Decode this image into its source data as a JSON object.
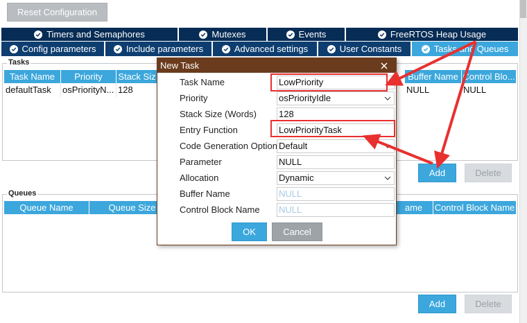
{
  "toolbar": {
    "reset_label": "Reset Configuration"
  },
  "tabs_row1": [
    {
      "label": "Timers and Semaphores"
    },
    {
      "label": "Mutexes"
    },
    {
      "label": "Events"
    },
    {
      "label": "FreeRTOS Heap Usage"
    }
  ],
  "tabs_row2": [
    {
      "label": "Config parameters"
    },
    {
      "label": "Include parameters"
    },
    {
      "label": "Advanced settings"
    },
    {
      "label": "User Constants"
    },
    {
      "label": "Tasks and Queues",
      "active": true
    }
  ],
  "tasks": {
    "title": "Tasks",
    "columns": [
      "Task Name",
      "Priority",
      "Stack Siz",
      "Buffer Name",
      "Control Blo..."
    ],
    "row": {
      "task_name": "defaultTask",
      "priority": "osPriorityN...",
      "stack": "128",
      "buffer": "NULL",
      "control": "NULL"
    },
    "add_label": "Add",
    "delete_label": "Delete"
  },
  "queues": {
    "title": "Queues",
    "columns": [
      "Queue Name",
      "Queue Size",
      "ame",
      "Control Block Name"
    ],
    "add_label": "Add",
    "delete_label": "Delete"
  },
  "dialog": {
    "title": "New Task",
    "fields": {
      "task_name": {
        "label": "Task Name",
        "value": "LowPriority"
      },
      "priority": {
        "label": "Priority",
        "value": "osPriorityIdle"
      },
      "stack_size": {
        "label": "Stack Size (Words)",
        "value": "128"
      },
      "entry_function": {
        "label": "Entry Function",
        "value": "LowPriorityTask"
      },
      "code_gen": {
        "label": "Code Generation Option",
        "value": "Default"
      },
      "parameter": {
        "label": "Parameter",
        "value": "NULL"
      },
      "allocation": {
        "label": "Allocation",
        "value": "Dynamic"
      },
      "buffer_name": {
        "label": "Buffer Name",
        "placeholder": "NULL"
      },
      "control_block_name": {
        "label": "Control Block Name",
        "placeholder": "NULL"
      }
    },
    "ok_label": "OK",
    "cancel_label": "Cancel"
  },
  "colors": {
    "tab_dark": "#072c55",
    "tab_active": "#3ca7dc",
    "dialog_title": "#6a3b1d",
    "annotation_red": "#e8302f"
  }
}
